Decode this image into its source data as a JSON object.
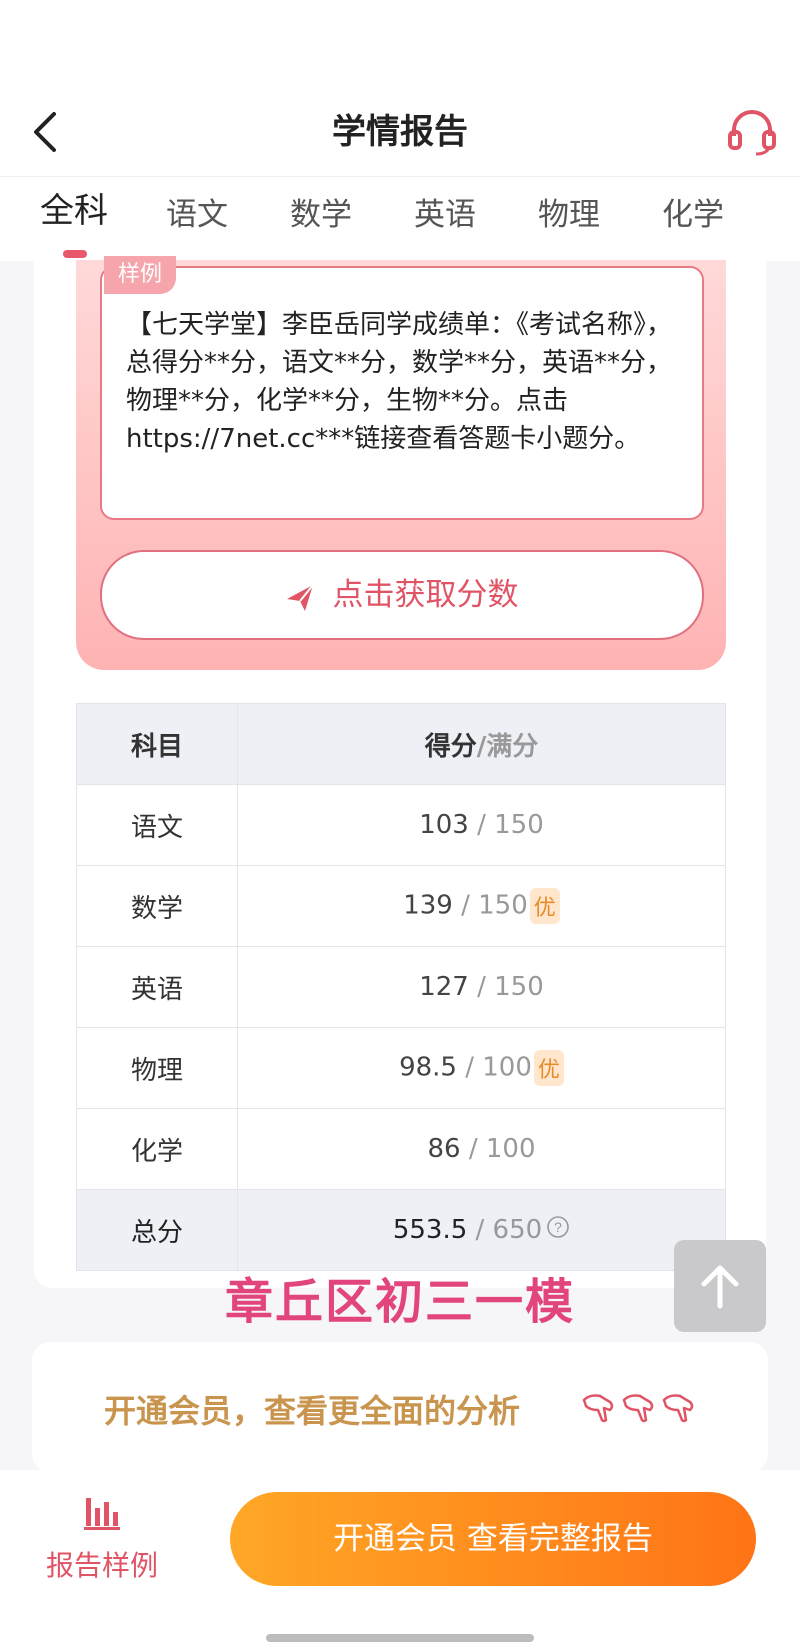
{
  "header": {
    "title": "学情报告"
  },
  "tabs": [
    "全科",
    "语文",
    "数学",
    "英语",
    "物理",
    "化学"
  ],
  "sample": {
    "tag": "样例",
    "text": "【七天学堂】李臣岳同学成绩单：《考试名称》，总得分**分，语文**分，数学**分，英语**分，物理**分，化学**分，生物**分。点击https://7net.cc***链接查看答题卡小题分。",
    "button_label": "点击获取分数"
  },
  "table": {
    "header_subject": "科目",
    "header_score": "得分",
    "header_full": "满分",
    "rows": [
      {
        "subject": "语文",
        "score": "103",
        "full": "150",
        "badge": ""
      },
      {
        "subject": "数学",
        "score": "139",
        "full": "150",
        "badge": "优"
      },
      {
        "subject": "英语",
        "score": "127",
        "full": "150",
        "badge": ""
      },
      {
        "subject": "物理",
        "score": "98.5",
        "full": "100",
        "badge": "优"
      },
      {
        "subject": "化学",
        "score": "86",
        "full": "100",
        "badge": ""
      }
    ],
    "total": {
      "subject": "总分",
      "score": "553.5",
      "full": "650"
    }
  },
  "watermark": "章丘区初三一模",
  "member_promo": "开通会员，查看更全面的分析",
  "bottom": {
    "report_sample_label": "报告样例",
    "open_member_label": "开通会员 查看完整报告"
  },
  "colors": {
    "accent": "#e05566",
    "orange": "#ff7416",
    "gold": "#c9954e",
    "watermark": "#e2457d"
  }
}
